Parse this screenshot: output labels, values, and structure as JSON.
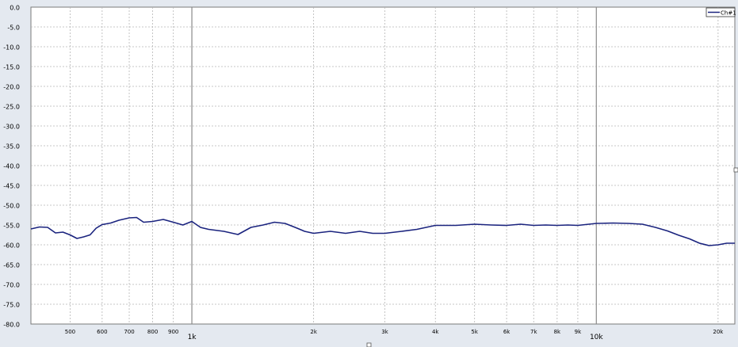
{
  "chart_data": {
    "type": "line",
    "title": "",
    "xlabel": "",
    "ylabel": "",
    "x_scale": "log",
    "xlim": [
      400,
      22000
    ],
    "ylim": [
      -80,
      0
    ],
    "grid": true,
    "legend": "top-right",
    "y_ticks": [
      "0.0",
      "-5.0",
      "-10.0",
      "-15.0",
      "-20.0",
      "-25.0",
      "-30.0",
      "-35.0",
      "-40.0",
      "-45.0",
      "-50.0",
      "-55.0",
      "-60.0",
      "-65.0",
      "-70.0",
      "-75.0",
      "-80.0"
    ],
    "y_tick_values": [
      0,
      -5,
      -10,
      -15,
      -20,
      -25,
      -30,
      -35,
      -40,
      -45,
      -50,
      -55,
      -60,
      -65,
      -70,
      -75,
      -80
    ],
    "x_ticks": [
      {
        "value": 500,
        "label": "500",
        "major": false
      },
      {
        "value": 600,
        "label": "600",
        "major": false
      },
      {
        "value": 700,
        "label": "700",
        "major": false
      },
      {
        "value": 800,
        "label": "800",
        "major": false
      },
      {
        "value": 900,
        "label": "900",
        "major": false
      },
      {
        "value": 1000,
        "label": "1k",
        "major": true
      },
      {
        "value": 2000,
        "label": "2k",
        "major": false
      },
      {
        "value": 3000,
        "label": "3k",
        "major": false
      },
      {
        "value": 4000,
        "label": "4k",
        "major": false
      },
      {
        "value": 5000,
        "label": "5k",
        "major": false
      },
      {
        "value": 6000,
        "label": "6k",
        "major": false
      },
      {
        "value": 7000,
        "label": "7k",
        "major": false
      },
      {
        "value": 8000,
        "label": "8k",
        "major": false
      },
      {
        "value": 9000,
        "label": "9k",
        "major": false
      },
      {
        "value": 10000,
        "label": "10k",
        "major": true
      },
      {
        "value": 20000,
        "label": "20k",
        "major": false
      }
    ],
    "series": [
      {
        "name": "Ch#1",
        "color": "#1a237e",
        "x": [
          400,
          420,
          440,
          460,
          480,
          500,
          520,
          540,
          560,
          580,
          600,
          630,
          660,
          700,
          730,
          760,
          800,
          850,
          900,
          950,
          1000,
          1050,
          1100,
          1200,
          1300,
          1400,
          1500,
          1600,
          1700,
          1800,
          1900,
          2000,
          2200,
          2400,
          2600,
          2800,
          3000,
          3300,
          3600,
          4000,
          4500,
          5000,
          5500,
          6000,
          6500,
          7000,
          7500,
          8000,
          8500,
          9000,
          10000,
          11000,
          12000,
          13000,
          14000,
          15000,
          16000,
          17000,
          18000,
          19000,
          20000,
          21000,
          22000
        ],
        "y": [
          -56.0,
          -55.5,
          -55.6,
          -57.0,
          -56.8,
          -57.5,
          -58.4,
          -58.0,
          -57.5,
          -55.8,
          -54.9,
          -54.5,
          -53.8,
          -53.2,
          -53.1,
          -54.3,
          -54.1,
          -53.6,
          -54.3,
          -55.0,
          -54.1,
          -55.6,
          -56.1,
          -56.6,
          -57.4,
          -55.6,
          -55.0,
          -54.3,
          -54.6,
          -55.6,
          -56.6,
          -57.1,
          -56.6,
          -57.1,
          -56.6,
          -57.1,
          -57.1,
          -56.6,
          -56.1,
          -55.1,
          -55.1,
          -54.8,
          -55.0,
          -55.1,
          -54.8,
          -55.1,
          -55.0,
          -55.1,
          -55.0,
          -55.1,
          -54.6,
          -54.5,
          -54.6,
          -54.8,
          -55.6,
          -56.5,
          -57.6,
          -58.5,
          -59.6,
          -60.2,
          -60.0,
          -59.6,
          -59.6
        ]
      }
    ]
  }
}
